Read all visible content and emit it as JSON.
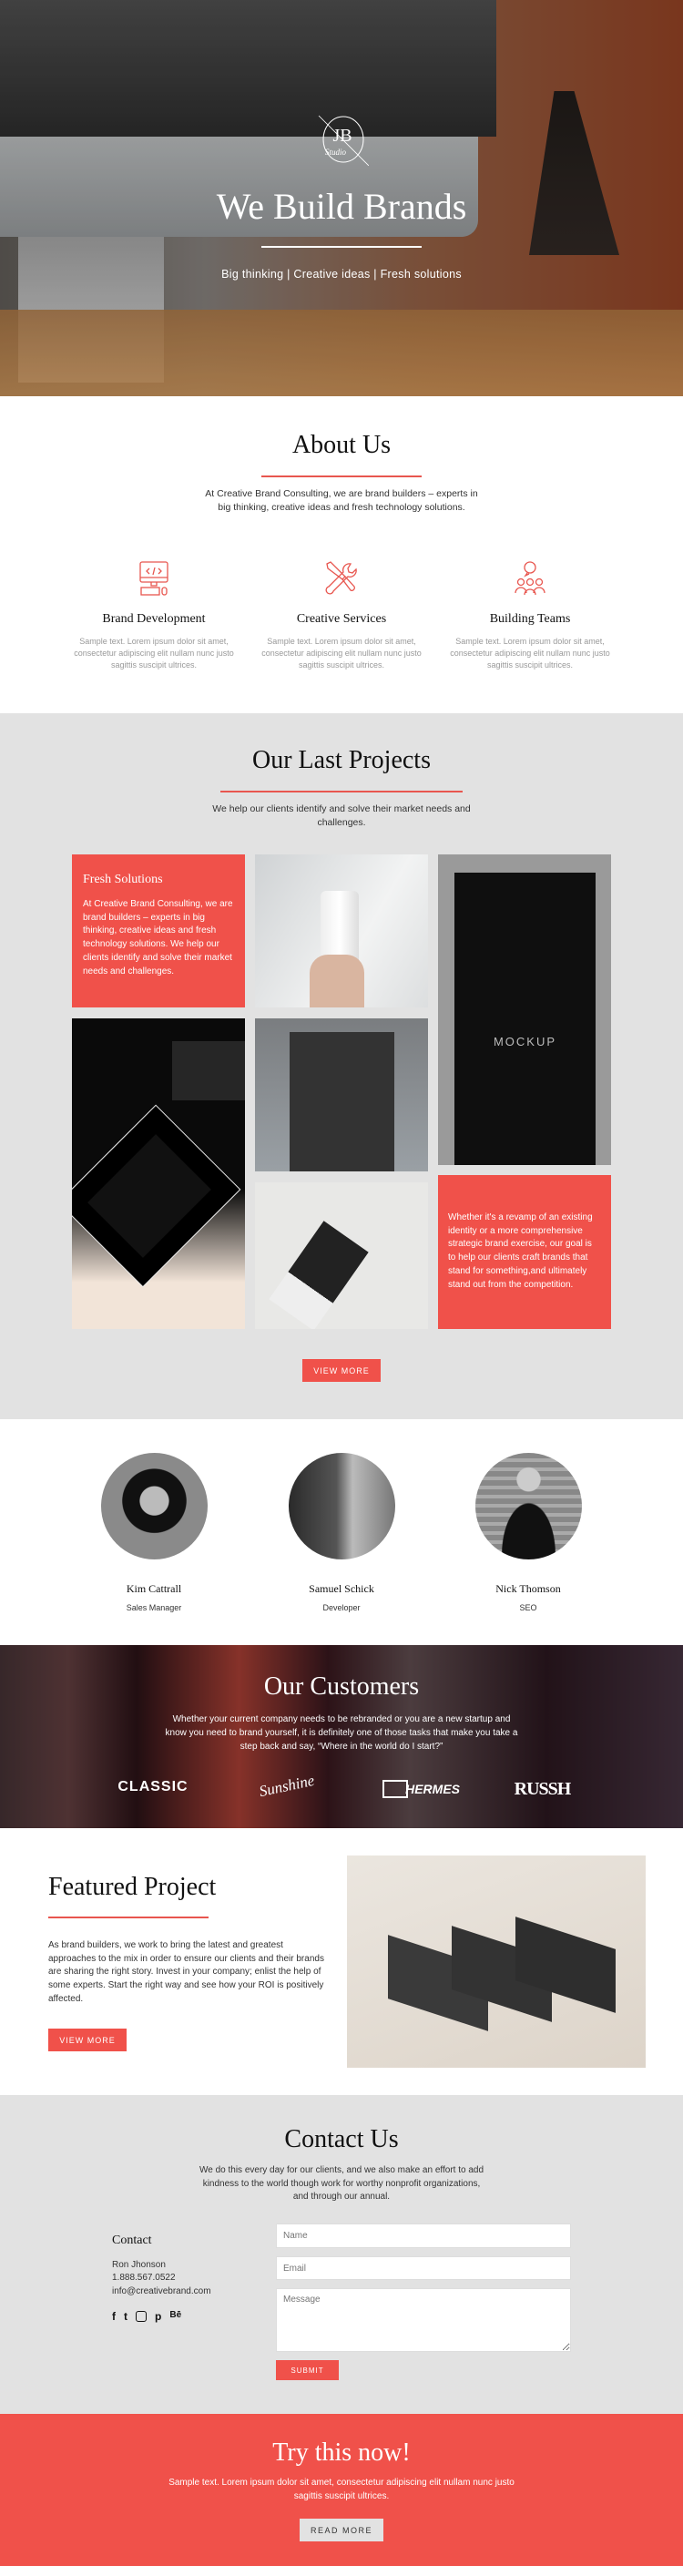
{
  "colors": {
    "accent": "#f0514a",
    "gray_bg": "#e2e2e2"
  },
  "hero": {
    "logo_letters": "JB",
    "logo_script": "Studio",
    "title": "We Build Brands",
    "subtitle": "Big thinking | Creative ideas | Fresh solutions"
  },
  "about": {
    "title": "About Us",
    "text": "At Creative Brand Consulting, we are brand builders – experts in big thinking, creative ideas and fresh technology solutions.",
    "features": [
      {
        "icon": "computer-code-icon",
        "title": "Brand Development",
        "text": "Sample text. Lorem ipsum dolor sit amet, consectetur adipiscing elit nullam nunc justo sagittis suscipit ultrices."
      },
      {
        "icon": "tools-icon",
        "title": "Creative Services",
        "text": "Sample text. Lorem ipsum dolor sit amet, consectetur adipiscing elit nullam nunc justo sagittis suscipit ultrices."
      },
      {
        "icon": "team-chat-icon",
        "title": "Building Teams",
        "text": "Sample text. Lorem ipsum dolor sit amet, consectetur adipiscing elit nullam nunc justo sagittis suscipit ultrices."
      }
    ]
  },
  "projects": {
    "title": "Our Last Projects",
    "text": "We help our clients identify and solve their market needs and challenges.",
    "card1_title": "Fresh Solutions",
    "card1_text": "At Creative Brand Consulting, we are brand builders – experts in big thinking, creative ideas and fresh technology solutions. We help our clients identify and solve their market needs and challenges.",
    "card2_text": "Whether it's a revamp of an existing identity or a more comprehensive strategic brand exercise, our goal is to help our clients craft brands that stand for something,and ultimately stand out from the competition.",
    "poster_text": "MOCKUP",
    "view_more": "VIEW MORE"
  },
  "team": [
    {
      "name": "Kim Cattrall",
      "role": "Sales Manager"
    },
    {
      "name": "Samuel Schick",
      "role": "Developer"
    },
    {
      "name": "Nick Thomson",
      "role": "SEO"
    }
  ],
  "customers": {
    "title": "Our Customers",
    "text": "Whether your current company needs to be rebranded or you are a new startup and know you need to brand yourself, it is definitely one of those tasks that make you take a step back and say, “Where in the world do I start?”",
    "logos": [
      "CLASSIC",
      "Sunshine",
      "HERMES",
      "RUSSH"
    ]
  },
  "featured": {
    "title": "Featured Project",
    "text": "As brand builders, we work to bring the latest and greatest approaches to the mix in order to ensure our clients and their brands are sharing the right story. Invest in your company; enlist the help of some experts. Start the right way and see how your ROI is positively affected.",
    "button": "VIEW MORE"
  },
  "contact": {
    "title": "Contact Us",
    "text": "We do this every day for our clients, and we also make an effort to add kindness to the world though work for worthy nonprofit organizations, and through our annual.",
    "heading": "Contact",
    "person": "Ron Jhonson",
    "phone": "1.888.567.0522",
    "email": "info@creativebrand.com",
    "social": [
      "facebook-icon",
      "twitter-icon",
      "instagram-icon",
      "pinterest-icon",
      "behance-icon"
    ],
    "name_placeholder": "Name",
    "email_placeholder": "Email",
    "message_placeholder": "Message",
    "submit": "SUBMIT"
  },
  "cta": {
    "title": "Try this now!",
    "text": "Sample text. Lorem ipsum dolor sit amet, consectetur adipiscing elit nullam nunc justo sagittis suscipit ultrices.",
    "button": "READ MORE"
  }
}
